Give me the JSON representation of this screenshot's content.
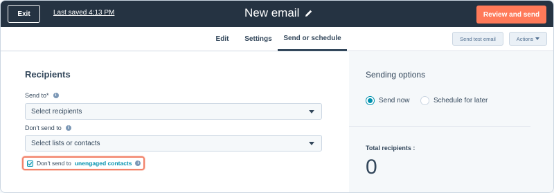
{
  "topbar": {
    "exit_label": "Exit",
    "last_saved": "Last saved 4:13 PM",
    "title": "New email",
    "review_label": "Review and send"
  },
  "tabs": [
    {
      "label": "Edit",
      "active": false
    },
    {
      "label": "Settings",
      "active": false
    },
    {
      "label": "Send or schedule",
      "active": true
    }
  ],
  "toolbar": {
    "send_test_label": "Send test email",
    "actions_label": "Actions"
  },
  "recipients": {
    "heading": "Recipients",
    "send_to_label": "Send to*",
    "send_to_placeholder": "Select recipients",
    "dont_send_label": "Don't send to",
    "dont_send_placeholder": "Select lists or contacts",
    "unengaged_prefix": "Don't send to",
    "unengaged_link": "unengaged contacts",
    "unengaged_checked": true
  },
  "sending_options": {
    "heading": "Sending options",
    "send_now": "Send now",
    "schedule_later": "Schedule for later",
    "selected": "send_now",
    "total_label": "Total recipients :",
    "total_value": "0"
  },
  "colors": {
    "topbar": "#253342",
    "accent_orange": "#ff7a59",
    "link_teal": "#0091ae",
    "highlight": "#f2826a"
  },
  "icons": [
    "pencil-icon",
    "info-icon",
    "dropdown-caret-icon",
    "checkmark-icon"
  ]
}
